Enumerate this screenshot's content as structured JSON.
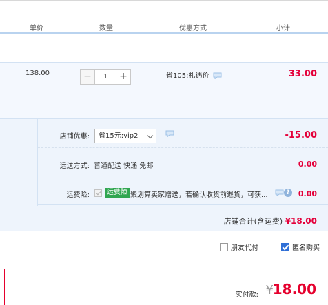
{
  "header": {
    "col_unit_price": "单价",
    "col_quantity": "数量",
    "col_promotion": "优惠方式",
    "col_subtotal": "小计"
  },
  "item": {
    "unit_price": "138.00",
    "qty_minus": "−",
    "quantity": "1",
    "qty_plus": "+",
    "promotion": "省105:礼遇价",
    "subtotal": "33.00"
  },
  "shop": {
    "discount_label": "店铺优惠:",
    "discount_select": "省15元:vip2",
    "discount_amount": "-15.00",
    "shipping_label": "运送方式:",
    "shipping_method": "普通配送 快递 免邮",
    "shipping_amount": "0.00",
    "insurance_label": "运费险:",
    "insurance_badge": "运费险",
    "insurance_text": "聚划算卖家赠送，若确认收货前退货，可获...",
    "insurance_amount": "0.00",
    "total_label": "店铺合计(含运费)",
    "total_amount": "¥18.00"
  },
  "options": {
    "friend_pay": "朋友代付",
    "friend_pay_checked": false,
    "anonymous": "匿名购买",
    "anonymous_checked": true
  },
  "payment": {
    "label": "实付款:",
    "currency": "¥",
    "amount": "18.00"
  },
  "colors": {
    "price_red": "#e4003a",
    "header_line": "#b9d3ef",
    "row_bg": "#eef4fc",
    "badge_green": "#31a651",
    "check_blue": "#2f6fd6"
  }
}
